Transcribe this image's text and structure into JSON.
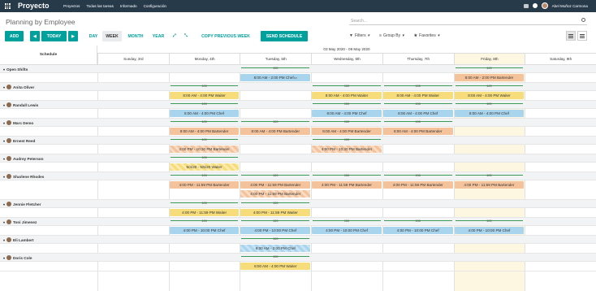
{
  "app": {
    "name": "Proyecto",
    "nav": [
      "Proyectos",
      "Todas las tareas",
      "Informado",
      "Configuración"
    ],
    "user": "Abel Muñoz Carmona"
  },
  "page": {
    "title": "Planning by Employee",
    "search_placeholder": "Search..."
  },
  "toolbar": {
    "add": "ADD",
    "today": "TODAY",
    "day": "DAY",
    "week": "WEEK",
    "month": "MONTH",
    "year": "YEAR",
    "copy_prev": "COPY PREVIOUS WEEK",
    "send": "SEND SCHEDULE",
    "filters": "Filters",
    "group_by": "Group By",
    "favorites": "Favorites"
  },
  "colors": {
    "accent": "#00a09d",
    "topbar": "#273a4a",
    "waiter": "#f6dc7a",
    "chef": "#a9d4ed",
    "bartender": "#f4c29b",
    "today": "#fdf7e1",
    "util_line": "#3a9b57"
  },
  "icons": [
    "apps-grid-icon",
    "notification-icon",
    "chat-icon",
    "search-icon",
    "prev-arrow-icon",
    "next-arrow-icon",
    "expand-icon",
    "compress-icon",
    "filter-icon",
    "group-icon",
    "star-icon",
    "list-view-icon",
    "gantt-view-icon",
    "caret-icon"
  ],
  "grid": {
    "schedule_label": "Schedule",
    "range": "03 May 2020 - 09 May 2020",
    "days": [
      "Sunday, 3rd",
      "Monday, 4th",
      "Tuesday, 5th",
      "Wednesday, 6th",
      "Thursday, 7th",
      "Friday, 8th",
      "Saturday, 9th"
    ],
    "today_index": 5,
    "util_value": "100"
  },
  "rows": [
    {
      "name": "Open Shifts",
      "avatar": false,
      "pills": [
        {
          "day": 2,
          "span": 1,
          "cls": "chef",
          "text": "8:00 AM - 2:00 PM Chef"
        },
        {
          "day": 5,
          "span": 1,
          "cls": "bartender",
          "text": "8:00 AM - 2:00 PM Bartender"
        }
      ],
      "util": [
        2,
        5
      ]
    },
    {
      "name": "Anita Oliver",
      "avatar": true,
      "pills": [
        {
          "day": 1,
          "span": 1,
          "cls": "waiter",
          "text": "8:00 AM - 4:00 PM Waiter"
        },
        {
          "day": 3,
          "span": 1,
          "cls": "waiter",
          "text": "8:00 AM - 4:00 PM Waiter"
        },
        {
          "day": 4,
          "span": 1,
          "cls": "waiter",
          "text": "8:00 AM - 4:00 PM Waiter"
        },
        {
          "day": 5,
          "span": 1,
          "cls": "waiter",
          "text": "8:00 AM - 4:00 PM Waiter"
        }
      ],
      "util": [
        1,
        3,
        4,
        5
      ]
    },
    {
      "name": "Randall Lewis",
      "avatar": true,
      "pills": [
        {
          "day": 1,
          "span": 1,
          "cls": "chef",
          "text": "8:00 AM - 4:00 PM Chef"
        },
        {
          "day": 3,
          "span": 1,
          "cls": "chef",
          "text": "8:00 AM - 4:00 PM Chef"
        },
        {
          "day": 4,
          "span": 1,
          "cls": "chef",
          "text": "8:00 AM - 4:00 PM Chef"
        },
        {
          "day": 5,
          "span": 1,
          "cls": "chef",
          "text": "8:00 AM - 4:00 PM Chef"
        }
      ],
      "util": [
        1,
        3,
        4,
        5
      ]
    },
    {
      "name": "Marc Demo",
      "avatar": true,
      "pills": [
        {
          "day": 1,
          "span": 1,
          "cls": "bartender",
          "text": "8:00 AM - 4:00 PM Bartender"
        },
        {
          "day": 2,
          "span": 1,
          "cls": "bartender",
          "text": "8:00 AM - 4:00 PM Bartender"
        },
        {
          "day": 3,
          "span": 1,
          "cls": "bartender",
          "text": "8:00 AM - 4:00 PM Bartender"
        },
        {
          "day": 4,
          "span": 1,
          "cls": "bartender",
          "text": "8:00 AM - 4:00 PM Bartender"
        }
      ],
      "util": [
        1,
        2,
        3,
        4
      ]
    },
    {
      "name": "Ernest Reed",
      "avatar": true,
      "pills": [
        {
          "day": 1,
          "span": 1,
          "cls": "striped-bar",
          "text": "4:00 PM - 10:30 PM Bartender"
        },
        {
          "day": 3,
          "span": 1,
          "cls": "striped-bar",
          "text": "4:00 PM - 10:30 PM Bartender"
        }
      ],
      "util": [
        1,
        3
      ]
    },
    {
      "name": "Audrey Peterson",
      "avatar": true,
      "pills": [
        {
          "day": 1,
          "span": 1,
          "cls": "striped-wai",
          "text": "5/4/20 - 5/5/20 Waiter"
        }
      ],
      "util": [
        1
      ]
    },
    {
      "name": "Sharlene Rhodes",
      "avatar": true,
      "pills": [
        {
          "day": 1,
          "span": 1,
          "cls": "bartender",
          "text": "4:00 PM - 11:59 PM Bartender"
        },
        {
          "day": 2,
          "span": 1,
          "cls": "bartender",
          "text": "4:00 PM - 11:59 PM Bartender"
        },
        {
          "day": 3,
          "span": 1,
          "cls": "bartender",
          "text": "4:00 PM - 11:59 PM Bartender"
        },
        {
          "day": 4,
          "span": 1,
          "cls": "bartender",
          "text": "4:00 PM - 11:59 PM Bartender"
        },
        {
          "day": 5,
          "span": 1,
          "cls": "bartender",
          "text": "4:00 PM - 11:59 PM Bartender"
        }
      ],
      "extra": {
        "day": 2,
        "cls": "striped-bar",
        "text": "4:00 PM - 11:59 PM Bartender"
      },
      "util": [
        1,
        2,
        3,
        4,
        5
      ]
    },
    {
      "name": "Jennie Fletcher",
      "avatar": true,
      "pills": [
        {
          "day": 1,
          "span": 1,
          "cls": "waiter",
          "text": "4:00 PM - 11:59 PM Waiter"
        },
        {
          "day": 2,
          "span": 1,
          "cls": "waiter",
          "text": "4:00 PM - 11:59 PM Waiter"
        }
      ],
      "util": [
        1,
        2
      ]
    },
    {
      "name": "Toni Jimenez",
      "avatar": true,
      "pills": [
        {
          "day": 1,
          "span": 1,
          "cls": "chef",
          "text": "4:00 PM - 10:00 PM Chef"
        },
        {
          "day": 2,
          "span": 1,
          "cls": "chef",
          "text": "4:00 PM - 10:00 PM Chef"
        },
        {
          "day": 3,
          "span": 1,
          "cls": "chef",
          "text": "4:00 PM - 10:00 PM Chef"
        },
        {
          "day": 4,
          "span": 1,
          "cls": "chef",
          "text": "4:00 PM - 10:00 PM Chef"
        },
        {
          "day": 5,
          "span": 1,
          "cls": "chef",
          "text": "4:00 PM - 10:00 PM Chef"
        }
      ],
      "util": [
        1,
        2,
        3,
        4,
        5
      ]
    },
    {
      "name": "Eli Lambert",
      "avatar": true,
      "pills": [
        {
          "day": 2,
          "span": 1,
          "cls": "striped-chef",
          "text": "9:00 AM - 2:00 PM Chef"
        }
      ],
      "util": [
        2
      ]
    },
    {
      "name": "Doris Cole",
      "avatar": true,
      "pills": [
        {
          "day": 2,
          "span": 1,
          "cls": "waiter",
          "text": "8:00 AM - 4:00 PM Waiter"
        }
      ],
      "util": [
        2
      ]
    }
  ]
}
